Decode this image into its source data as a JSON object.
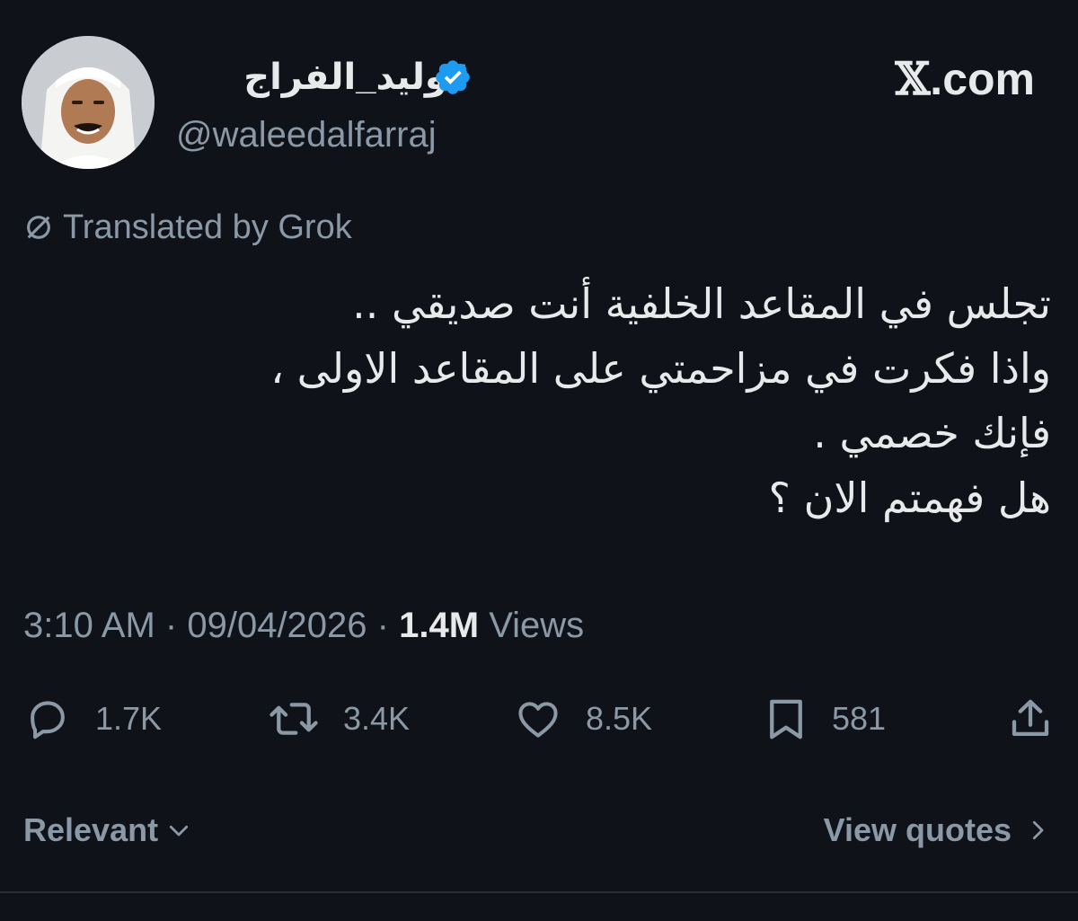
{
  "author": {
    "display_name": "#وليد_الفراج",
    "handle": "@waleedalfarraj"
  },
  "brand": {
    "glyph": "𝕏",
    "domain": ".com"
  },
  "translation": {
    "label": "Translated by Grok"
  },
  "tweet": {
    "lines": [
      "تجلس في المقاعد الخلفية أنت صديقي ..",
      "واذا فكرت في مزاحمتي على المقاعد الاولى ،",
      "فإنك خصمي .",
      "هل فهمتم الان ؟"
    ],
    "time": "3:10 AM",
    "separator": "·",
    "date": "09/04/2026",
    "views_count": "1.4M",
    "views_label": "Views"
  },
  "actions": {
    "reply": "1.7K",
    "retweet": "3.4K",
    "like": "8.5K",
    "bookmark": "581"
  },
  "footer": {
    "sort_label": "Relevant",
    "quotes_label": "View quotes"
  },
  "colors": {
    "background": "#10121a",
    "verified": "#1d9bf0",
    "muted": "#8b98a5",
    "text": "#e7e9ea"
  },
  "icons": [
    "verified-badge-icon",
    "no-translate-icon",
    "reply-icon",
    "retweet-icon",
    "like-icon",
    "bookmark-icon",
    "share-icon",
    "chevron-down-icon",
    "chevron-right-icon"
  ]
}
